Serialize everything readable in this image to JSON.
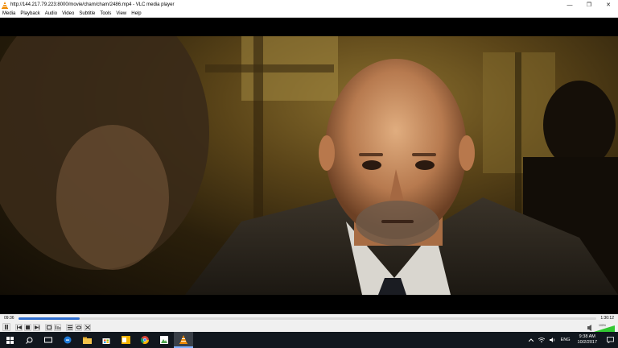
{
  "window": {
    "title": "http://144.217.79.223:8000/movie/cham/cham/2486.mp4 - VLC media player",
    "controls": {
      "minimize": "—",
      "maximize": "❐",
      "close": "✕"
    }
  },
  "menu": [
    "Media",
    "Playback",
    "Audio",
    "Video",
    "Subtitle",
    "Tools",
    "View",
    "Help"
  ],
  "player": {
    "elapsed": "09:36",
    "total": "1:30:12",
    "progress": 0.107,
    "volume_level": 1.0,
    "volume_label": "100%"
  },
  "taskbar": {
    "language": "ENG",
    "time": "9:38 AM",
    "date": "10/2/2017"
  },
  "colors": {
    "seek_fill": "#2f6fd1",
    "taskbar_bg": "#11171e",
    "vlc_orange": "#f08a00",
    "volume_green": "#32c832"
  }
}
